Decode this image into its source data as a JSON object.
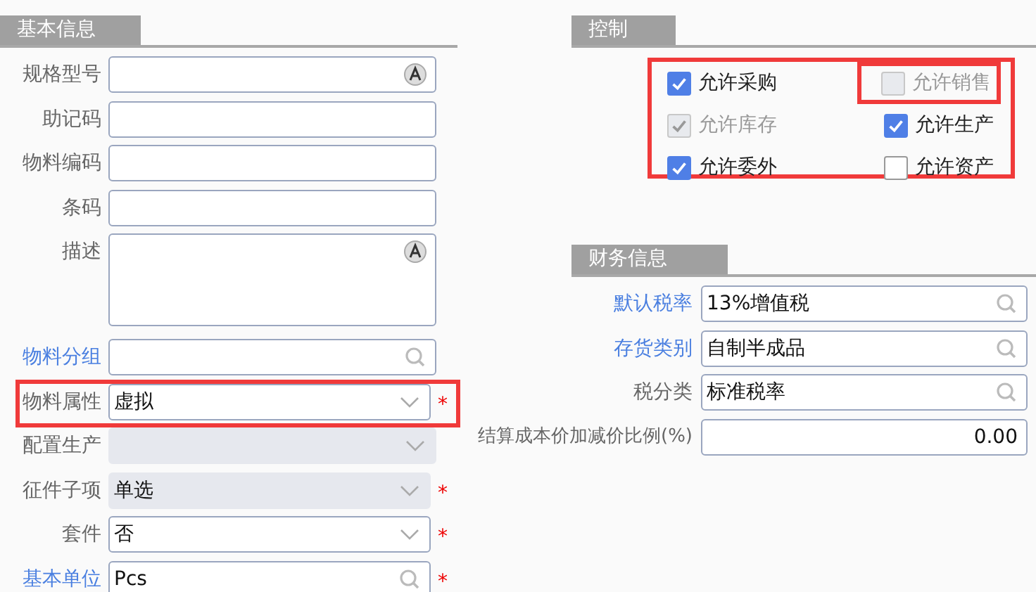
{
  "basic_info": {
    "title": "基本信息",
    "fields": [
      {
        "label": "规格型号",
        "kind": "text",
        "multilang": true,
        "link": false,
        "disabled": false,
        "highlighted": false
      },
      {
        "label": "助记码",
        "kind": "text",
        "multilang": false,
        "link": false,
        "disabled": false,
        "highlighted": false
      },
      {
        "label": "物料编码",
        "kind": "text",
        "multilang": false,
        "link": false,
        "disabled": false,
        "highlighted": false
      },
      {
        "label": "条码",
        "kind": "text",
        "multilang": false,
        "link": false,
        "disabled": false,
        "highlighted": false
      },
      {
        "label": "描述",
        "kind": "textarea",
        "multilang": true,
        "link": false,
        "disabled": false,
        "highlighted": false
      },
      {
        "label": "物料分组",
        "kind": "lookup",
        "multilang": false,
        "link": true,
        "disabled": false,
        "highlighted": false
      },
      {
        "label": "物料属性",
        "kind": "select",
        "multilang": false,
        "link": false,
        "value": "虚拟",
        "required_mark": "*",
        "disabled": false,
        "highlighted": true
      },
      {
        "label": "配置生产",
        "kind": "select",
        "multilang": false,
        "link": false,
        "disabled": true,
        "highlighted": false
      },
      {
        "label": "征件子项",
        "kind": "select",
        "multilang": false,
        "link": false,
        "value": "单选",
        "required_mark": "*",
        "disabled": true,
        "highlighted": false
      },
      {
        "label": "套件",
        "kind": "select",
        "multilang": false,
        "link": false,
        "value": "否",
        "required_mark": "*",
        "disabled": false,
        "highlighted": false
      },
      {
        "label": "基本单位",
        "kind": "lookup",
        "multilang": false,
        "link": true,
        "value": "Pcs",
        "required_mark": "*",
        "disabled": false,
        "highlighted": false
      }
    ]
  },
  "control": {
    "title": "控制",
    "highlighted": true,
    "options": [
      {
        "label": "允许采购",
        "checked": true,
        "disabled": false,
        "highlighted": false
      },
      {
        "label": "允许销售",
        "checked": false,
        "disabled": true,
        "highlighted": true
      },
      {
        "label": "允许库存",
        "checked": true,
        "disabled": true,
        "highlighted": false
      },
      {
        "label": "允许生产",
        "checked": true,
        "disabled": false,
        "highlighted": false
      },
      {
        "label": "允许委外",
        "checked": true,
        "disabled": false,
        "highlighted": false
      },
      {
        "label": "允许资产",
        "checked": false,
        "disabled": false,
        "highlighted": false
      }
    ]
  },
  "finance": {
    "title": "财务信息",
    "fields": [
      {
        "label": "默认税率",
        "kind": "lookup",
        "link": true,
        "value": "13%增值税"
      },
      {
        "label": "存货类别",
        "kind": "lookup",
        "link": true,
        "value": "自制半成品"
      },
      {
        "label": "税分类",
        "kind": "lookup",
        "link": false,
        "value": "标准税率"
      },
      {
        "label": "结算成本价加减价比例(%)",
        "kind": "number",
        "link": false,
        "value": "0.00"
      }
    ]
  }
}
